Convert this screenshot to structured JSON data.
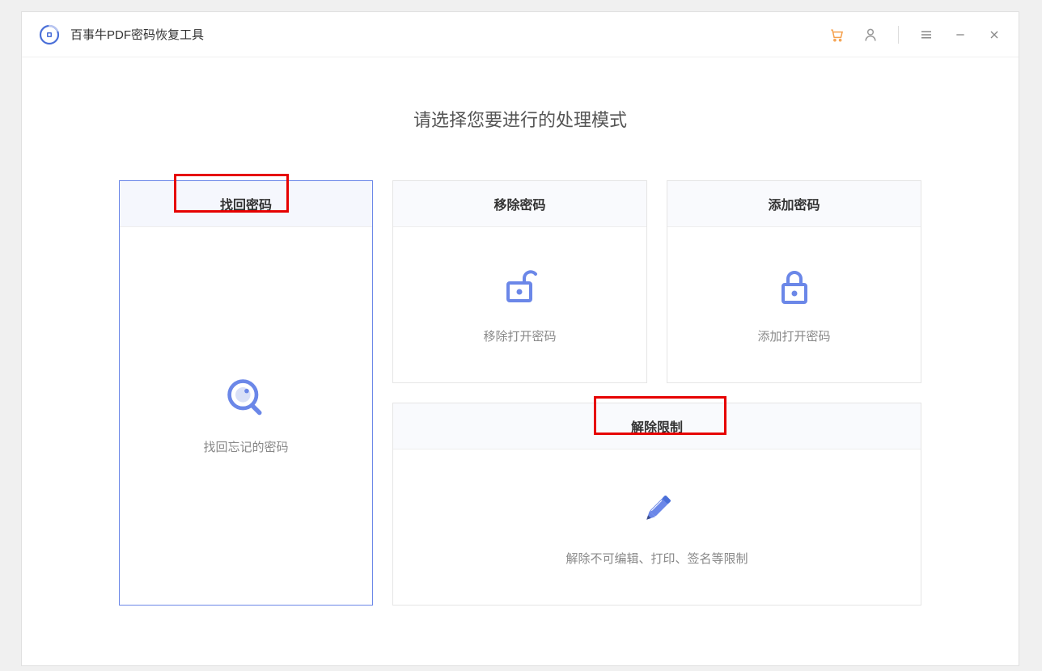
{
  "app": {
    "title": "百事牛PDF密码恢复工具"
  },
  "main": {
    "heading": "请选择您要进行的处理模式"
  },
  "cards": {
    "recover": {
      "title": "找回密码",
      "description": "找回忘记的密码"
    },
    "remove": {
      "title": "移除密码",
      "description": "移除打开密码"
    },
    "add": {
      "title": "添加密码",
      "description": "添加打开密码"
    },
    "unrestrict": {
      "title": "解除限制",
      "description": "解除不可编辑、打印、签名等限制"
    }
  }
}
